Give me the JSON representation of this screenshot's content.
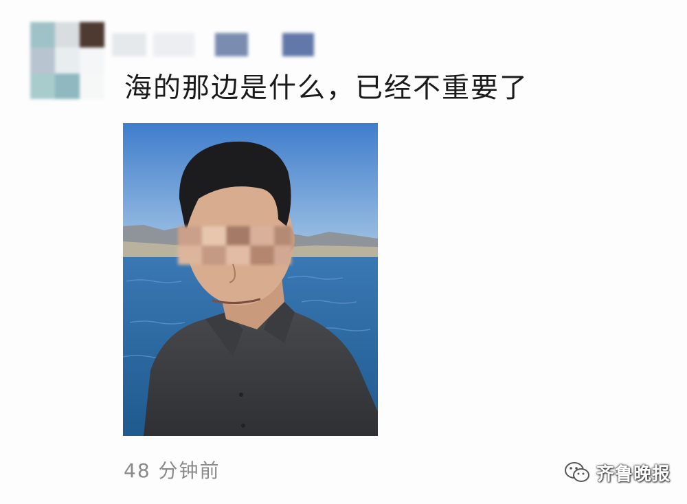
{
  "post": {
    "text": "海的那边是什么，已经不重要了",
    "time": "48 分钟前"
  },
  "watermark": {
    "text": "齐鲁晚报",
    "icon": "wechat-icon"
  },
  "colors": {
    "post_text": "#1a1a1a",
    "time_text": "#8a8a8a",
    "sky": "#4a7fc8",
    "water": "#2f6aa6"
  },
  "mosaic": {
    "avatar_tiles": [
      "#9fc2c8",
      "#d8dde0",
      "#4d3a30",
      "#b8c4d0",
      "#e8eef0",
      "#f4f6f7",
      "#a8cccc",
      "#8fb8c0",
      "#f6f8f8"
    ],
    "nickname_tiles": [
      "#e6e9ec",
      "#eceef2",
      "#7a8cb0",
      "#6278a8"
    ]
  }
}
